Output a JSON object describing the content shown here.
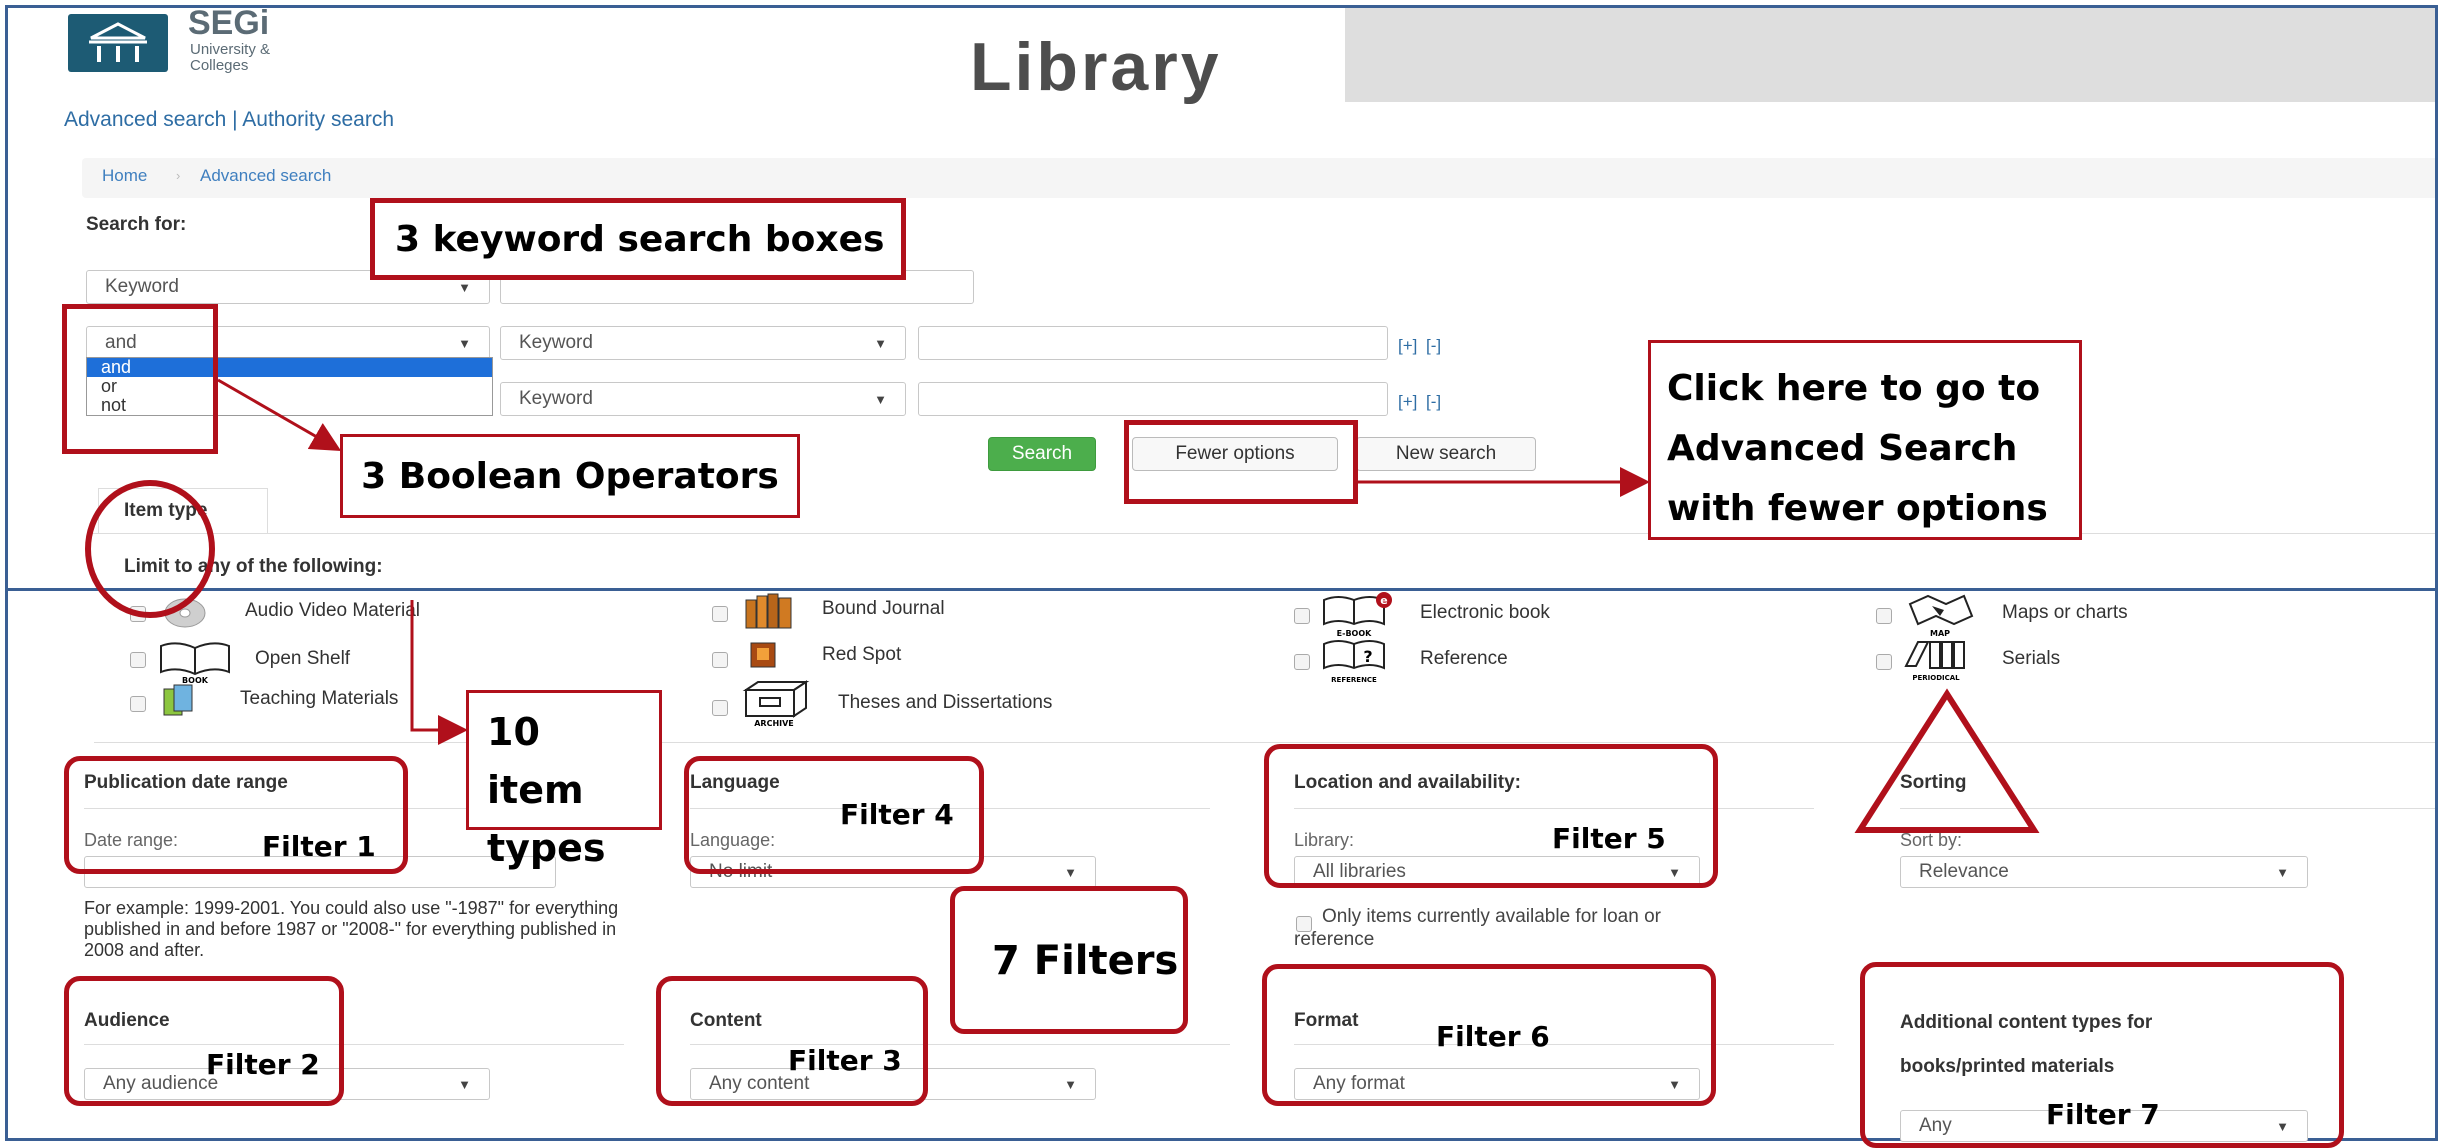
{
  "header": {
    "brand_name": "SEGi",
    "brand_sub_line1": "University &",
    "brand_sub_line2": "Colleges",
    "title": "Library"
  },
  "top_links": {
    "advanced": "Advanced search",
    "separator": "|",
    "authority": "Authority search"
  },
  "breadcrumb": {
    "home": "Home",
    "separator": "›",
    "current": "Advanced search"
  },
  "search": {
    "label": "Search for:",
    "row1_field": "Keyword",
    "row2_operator": "and",
    "row2_field": "Keyword",
    "row3_field": "Keyword",
    "plus": "[+]",
    "minus": "[-]",
    "operator_options": [
      "and",
      "or",
      "not"
    ]
  },
  "buttons": {
    "search": "Search",
    "fewer": "Fewer options",
    "new": "New search"
  },
  "item_type": {
    "tab_label": "Item type",
    "limit_label": "Limit to any of the following:",
    "items": {
      "audio": "Audio Video Material",
      "bound": "Bound Journal",
      "ebook": "Electronic book",
      "maps": "Maps or charts",
      "open": "Open Shelf",
      "red": "Red Spot",
      "reference": "Reference",
      "serials": "Serials",
      "teaching": "Teaching Materials",
      "theses": "Theses and Dissertations"
    },
    "icon_captions": {
      "book": "BOOK",
      "archive": "ARCHIVE",
      "ebook": "E-BOOK",
      "reference": "REFERENCE",
      "map": "MAP",
      "periodical": "PERIODICAL"
    }
  },
  "filters": {
    "pubdate": {
      "heading": "Publication date range",
      "label": "Date range:",
      "hint": "For example: 1999-2001. You could also use \"-1987\" for everything published in and before 1987 or \"2008-\" for everything published in 2008 and after."
    },
    "language": {
      "heading": "Language",
      "label": "Language:",
      "value": "No limit"
    },
    "location": {
      "heading": "Location and availability:",
      "label": "Library:",
      "value": "All libraries",
      "checkbox_line1": "Only items currently available for loan or",
      "checkbox_line2": "reference"
    },
    "sorting": {
      "heading": "Sorting",
      "label": "Sort by:",
      "value": "Relevance"
    },
    "audience": {
      "heading": "Audience",
      "value": "Any audience"
    },
    "content": {
      "heading": "Content",
      "value": "Any content"
    },
    "format": {
      "heading": "Format",
      "value": "Any format"
    },
    "additional": {
      "heading_line1": "Additional content types for",
      "heading_line2": "books/printed materials",
      "value": "Any"
    }
  },
  "annotations": {
    "keyword_boxes": "3 keyword search boxes",
    "boolean": "3 Boolean Operators",
    "fewer_line1": "Click here to go to",
    "fewer_line2": "Advanced Search",
    "fewer_line3": "with fewer options",
    "item_types_line1": "10 item",
    "item_types_line2": "types",
    "seven_filters": "7 Filters",
    "filter1": "Filter 1",
    "filter2": "Filter 2",
    "filter3": "Filter 3",
    "filter4": "Filter 4",
    "filter5": "Filter 5",
    "filter6": "Filter 6",
    "filter7": "Filter 7"
  },
  "colors": {
    "annotation_red": "#b0101b",
    "frame_blue": "#3a5f94",
    "search_green": "#4cae4c",
    "link_blue": "#2e6da4"
  }
}
